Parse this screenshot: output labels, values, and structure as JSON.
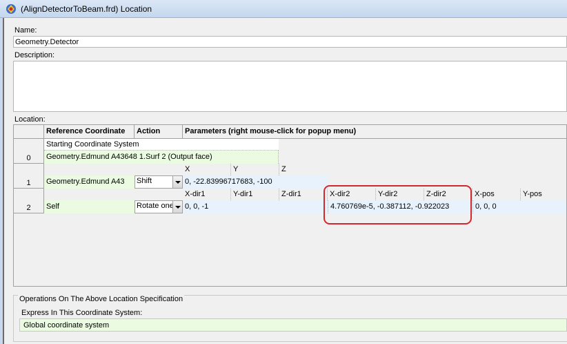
{
  "window": {
    "title": "(AlignDetectorToBeam.frd) Location"
  },
  "name": {
    "label": "Name:",
    "value": "Geometry.Detector"
  },
  "description": {
    "label": "Description:",
    "value": ""
  },
  "location": {
    "label": "Location:",
    "columns": {
      "reference": "Reference Coordinate",
      "action": "Action",
      "parameters": "Parameters (right mouse-click for popup menu)"
    },
    "rows": [
      {
        "index": "0",
        "top_text": "Starting Coordinate System",
        "reference": "Geometry.Edmund A43648 1.Surf 2   (Output face)"
      },
      {
        "index": "1",
        "reference": "Geometry.Edmund A43",
        "action": "Shift",
        "param_headers": [
          "X",
          "Y",
          "Z"
        ],
        "params": "0,  -22.83996717683,  -100"
      },
      {
        "index": "2",
        "reference": "Self",
        "action": "Rotate one",
        "param_headers": [
          "X-dir1",
          "Y-dir1",
          "Z-dir1",
          "X-dir2",
          "Y-dir2",
          "Z-dir2",
          "X-pos",
          "Y-pos"
        ],
        "params_dir1": "0,  0,  -1",
        "params_dir2": "4.760769e-5,  -0.387112,  -0.922023",
        "params_pos": "0,  0,  0"
      }
    ]
  },
  "operations": {
    "title": "Operations On The Above Location Specification",
    "express_label": "Express In This Coordinate System:",
    "express_value": "Global coordinate system"
  },
  "colors": {
    "highlight": "#d0282c",
    "reference_cell": "#eafbe2",
    "param_cell": "#e8f2fc"
  },
  "icons": [
    "app-icon",
    "combo-dropdown-icon"
  ]
}
